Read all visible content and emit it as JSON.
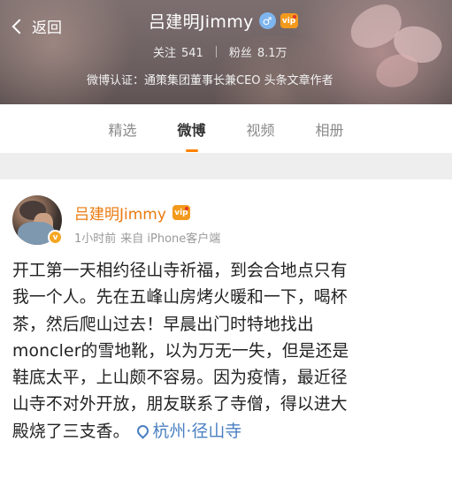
{
  "header": {
    "back_label": "返回",
    "name": "吕建明Jimmy",
    "gender_icon": "male-icon",
    "vip_icon": "vip-badge",
    "follow_label": "关注",
    "follow_count": "541",
    "fans_label": "粉丝",
    "fans_count": "8.1万",
    "verification": "微博认证：通策集团董事长兼CEO 头条文章作者"
  },
  "tabs": [
    {
      "label": "精选",
      "active": false
    },
    {
      "label": "微博",
      "active": true
    },
    {
      "label": "视频",
      "active": false
    },
    {
      "label": "相册",
      "active": false
    }
  ],
  "post": {
    "author": "吕建明Jimmy",
    "time": "1小时前",
    "source": "来自 iPhone客户端",
    "content_lines": [
      "开工第一天相约径山寺祈福，到会合地点只有",
      "我一个人。先在五峰山房烤火暖和一下，喝杯",
      "茶，然后爬山过去！早晨出门时特地找出",
      "moncler的雪地靴，以为万无一失，但是还是",
      "鞋底太平，上山颇不容易。因为疫情，最近径",
      "山寺不对外开放，朋友联系了寺僧，得以进大",
      "殿烧了三支香。"
    ],
    "location": "杭州·径山寺"
  },
  "colors": {
    "accent_orange": "#ff8200",
    "name_orange": "#ea7a0e",
    "link_blue": "#4a7fc1"
  }
}
